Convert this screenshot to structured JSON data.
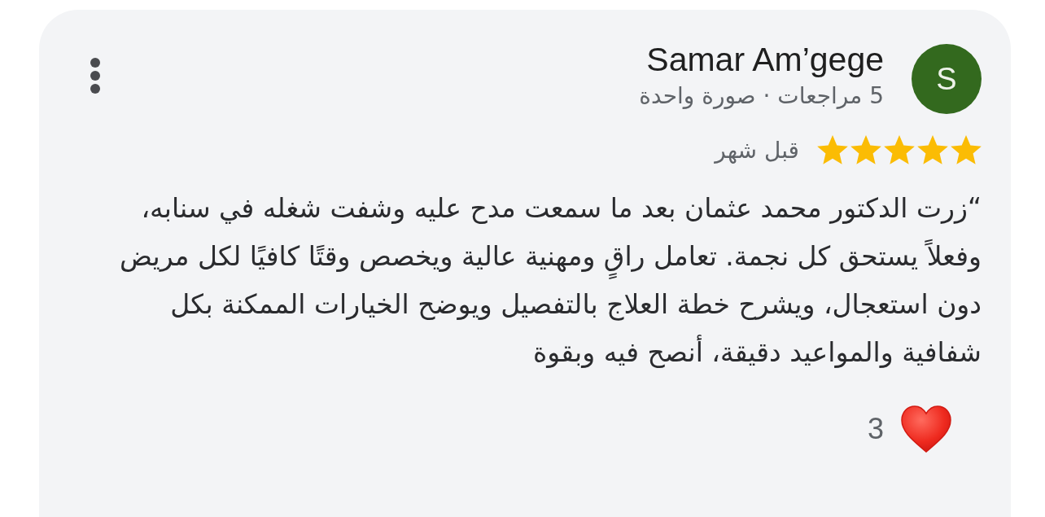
{
  "review": {
    "author": {
      "name": "Samar Am’gege",
      "initial": "S",
      "meta": "5 مراجعات · صورة واحدة"
    },
    "rating": {
      "stars": 5
    },
    "time": "قبل شهر",
    "text": "“زرت الدكتور محمد عثمان بعد ما سمعت مدح عليه وشفت شغله في سنابه، وفعلاً يستحق كل نجمة. تعامل راقٍ ومهنية عالية ويخصص وقتًا كافيًا لكل مريض دون استعجال، ويشرح خطة العلاج بالتفصيل ويوضح الخيارات الممكنة بكل شفافية والمواعيد دقيقة، أنصح فيه وبقوة",
    "reactions": {
      "count": "3"
    }
  }
}
